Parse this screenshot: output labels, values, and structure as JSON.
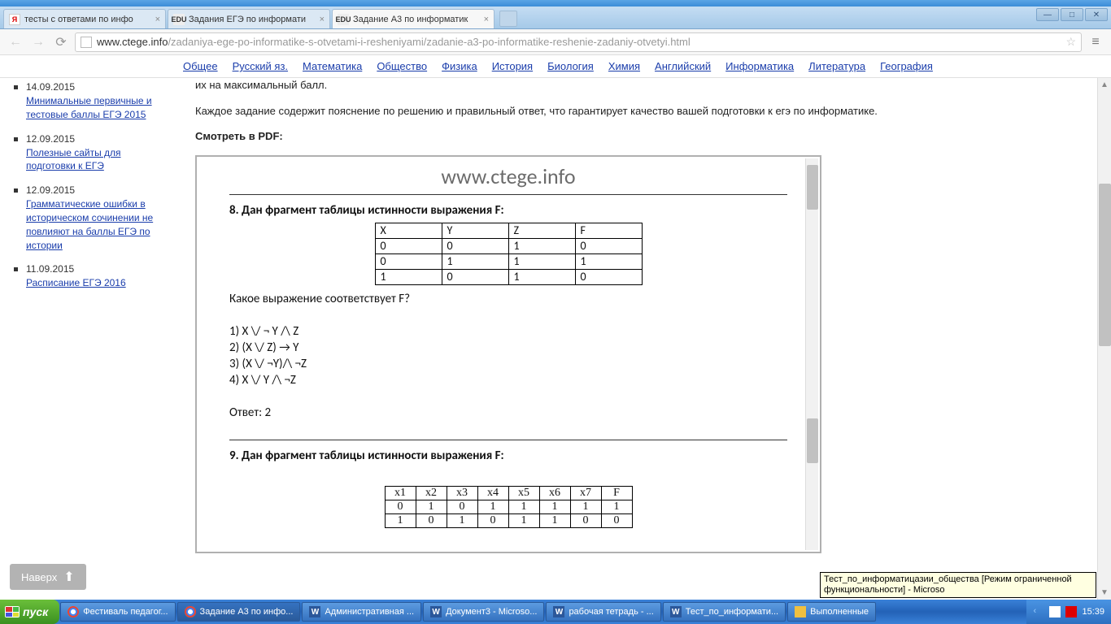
{
  "browser": {
    "tabs": [
      {
        "favicon": "Я",
        "title": "тесты с ответами по инфо"
      },
      {
        "favicon": "EDU",
        "title": "Задания ЕГЭ по информати"
      },
      {
        "favicon": "EDU",
        "title": "Задание А3 по информатик"
      }
    ],
    "url_domain": "www.ctege.info",
    "url_path": "/zadaniya-ege-po-informatike-s-otvetami-i-resheniyami/zadanie-a3-po-informatike-reshenie-zadaniy-otvetyi.html"
  },
  "nav_links": [
    "Общее",
    "Русский яз.",
    "Математика",
    "Общество",
    "Физика",
    "История",
    "Биология",
    "Химия",
    "Английский",
    "Информатика",
    "Литература",
    "География"
  ],
  "sidebar": [
    {
      "date": "14.09.2015",
      "link": "Минимальные первичные и тестовые баллы ЕГЭ 2015"
    },
    {
      "date": "12.09.2015",
      "link": "Полезные сайты для подготовки к ЕГЭ"
    },
    {
      "date": "12.09.2015",
      "link": "Грамматические ошибки в историческом сочинении не повлияют на баллы ЕГЭ по истории"
    },
    {
      "date": "11.09.2015",
      "link": "Расписание ЕГЭ 2016"
    }
  ],
  "content": {
    "para1": "их на максимальный балл.",
    "para2": "Каждое задание содержит пояснение по решению и правильный ответ, что гарантирует качество вашей подготовки к егэ по информатике.",
    "pdf_label": "Смотреть в PDF:"
  },
  "pdf": {
    "watermark": "www.ctege.info",
    "q8_title": "8. Дан фрагмент таблицы истинности выражения F:",
    "t1": {
      "headers": [
        "X",
        "Y",
        "Z",
        "F"
      ],
      "rows": [
        [
          "0",
          "0",
          "1",
          "0"
        ],
        [
          "0",
          "1",
          "1",
          "1"
        ],
        [
          "1",
          "0",
          "1",
          "0"
        ]
      ]
    },
    "q8_sub": "Какое выражение соответствует F?",
    "q8_opts": [
      "1) X \\/ ¬ Y /\\ Z",
      "2) (X \\/ Z) → Y",
      "3) (X \\/ ¬Y)/\\ ¬Z",
      "4) X \\/ Y /\\ ¬Z"
    ],
    "q8_ans": "Ответ: 2",
    "q9_title": "9. Дан фрагмент таблицы истинности выражения F:",
    "t2": {
      "headers": [
        "x1",
        "x2",
        "x3",
        "x4",
        "x5",
        "x6",
        "x7",
        "F"
      ],
      "rows": [
        [
          "0",
          "1",
          "0",
          "1",
          "1",
          "1",
          "1",
          "1"
        ],
        [
          "1",
          "0",
          "1",
          "0",
          "1",
          "1",
          "0",
          "0"
        ]
      ]
    }
  },
  "scroll_top": "Наверх",
  "tooltip": "Тест_по_информатицазии_общества [Режим ограниченной функциональности] - Microso",
  "taskbar": {
    "start": "пуск",
    "items": [
      {
        "icon": "chrome",
        "label": "Фестиваль педагог..."
      },
      {
        "icon": "chrome",
        "label": "Задание А3 по инфо...",
        "active": true
      },
      {
        "icon": "word",
        "label": "Административная ..."
      },
      {
        "icon": "word",
        "label": "Документ3 - Microso..."
      },
      {
        "icon": "word",
        "label": "рабочая тетрадь - ..."
      },
      {
        "icon": "word",
        "label": "Тест_по_информати..."
      },
      {
        "icon": "folder",
        "label": "Выполненные"
      }
    ],
    "clock": "15:39"
  }
}
